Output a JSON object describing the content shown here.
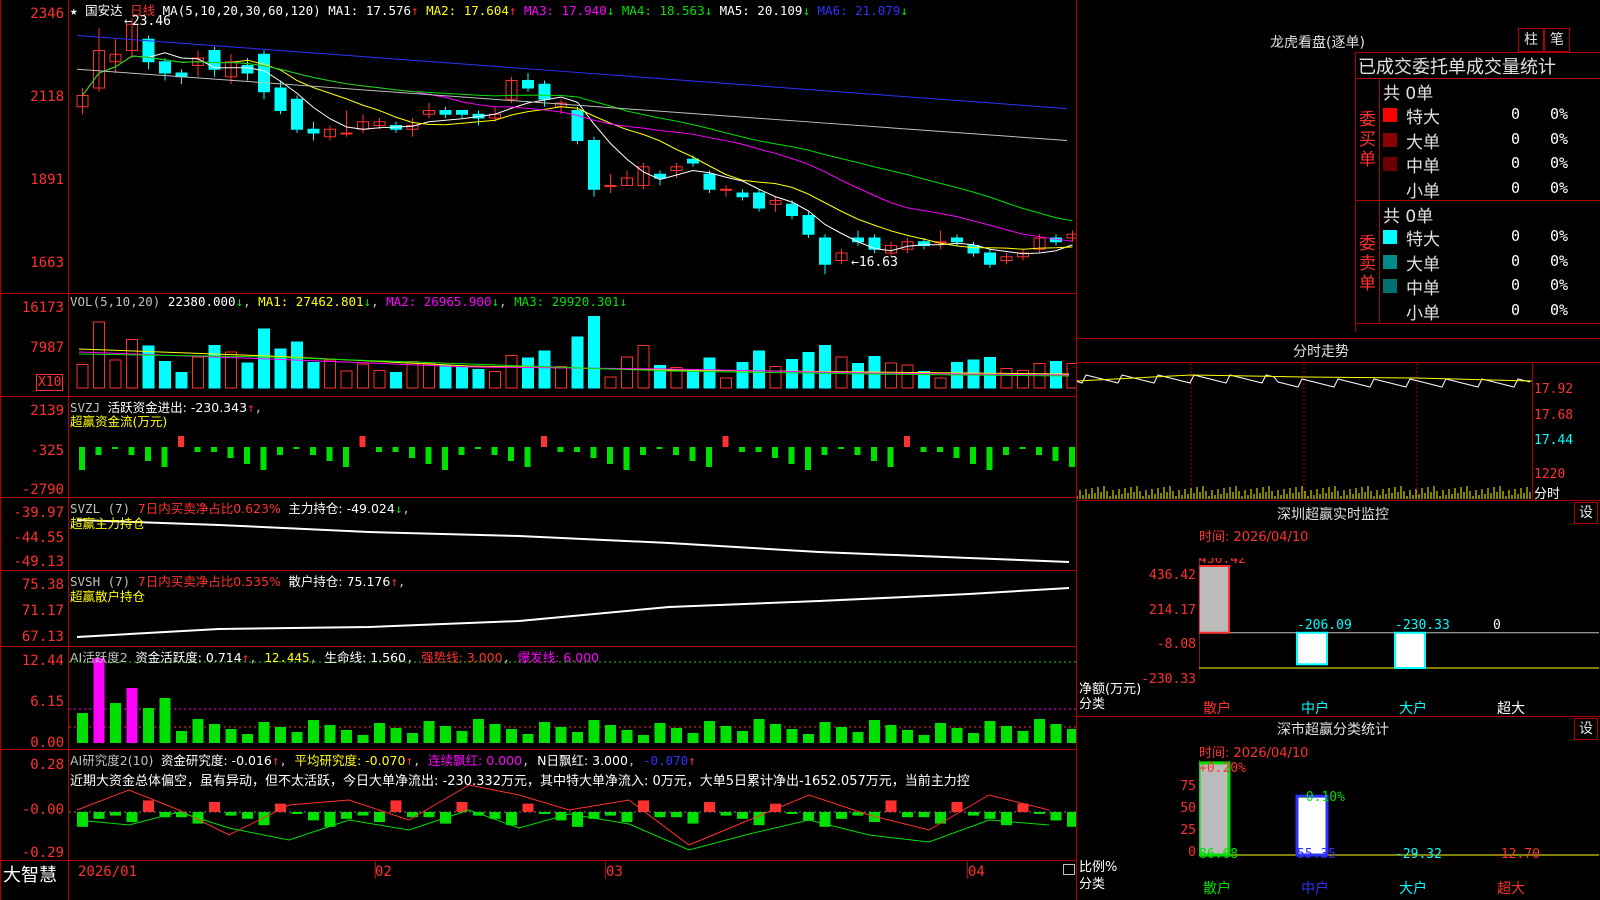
{
  "colors": {
    "up": "#ff3030",
    "down": "#00ffff",
    "ma1": "#ffffff",
    "ma2": "#ffff00",
    "ma3": "#ff00ff",
    "ma4": "#00e000",
    "ma5": "#c0c0c0",
    "ma6": "#3030ff",
    "grid": "#b00000"
  },
  "header": {
    "star_icon": "star-icon",
    "stock_name": "国安达",
    "period": "日线",
    "ma_params": "MA(5,10,20,30,60,120)",
    "ma1": "MA1: 17.576",
    "ma2": "MA2: 17.604",
    "ma3": "MA3: 17.940",
    "ma4": "MA4: 18.563",
    "ma5": "MA5: 20.109",
    "ma6": "MA6: 21.079",
    "arrow_up": "↑",
    "arrow_down": "↓"
  },
  "price_panel": {
    "y_labels": [
      "2346",
      "2118",
      "1891",
      "1663"
    ],
    "high_mark": "23.46",
    "low_mark": "16.63",
    "candles": [
      {
        "o": 21.1,
        "c": 21.4,
        "h": 21.6,
        "l": 20.9
      },
      {
        "o": 21.6,
        "c": 22.6,
        "h": 23.2,
        "l": 21.5
      },
      {
        "o": 22.3,
        "c": 22.5,
        "h": 22.9,
        "l": 22.0
      },
      {
        "o": 22.6,
        "c": 23.3,
        "h": 23.46,
        "l": 22.4
      },
      {
        "o": 22.9,
        "c": 22.3,
        "h": 23.0,
        "l": 22.1
      },
      {
        "o": 22.3,
        "c": 22.0,
        "h": 22.4,
        "l": 21.8
      },
      {
        "o": 22.0,
        "c": 21.9,
        "h": 22.1,
        "l": 21.7
      },
      {
        "o": 22.2,
        "c": 22.4,
        "h": 22.6,
        "l": 21.9
      },
      {
        "o": 22.6,
        "c": 22.1,
        "h": 22.7,
        "l": 21.9
      },
      {
        "o": 21.9,
        "c": 22.3,
        "h": 22.5,
        "l": 21.7
      },
      {
        "o": 22.2,
        "c": 22.0,
        "h": 22.4,
        "l": 21.8
      },
      {
        "o": 22.5,
        "c": 21.5,
        "h": 22.6,
        "l": 21.3
      },
      {
        "o": 21.6,
        "c": 21.0,
        "h": 21.8,
        "l": 20.9
      },
      {
        "o": 21.3,
        "c": 20.5,
        "h": 21.4,
        "l": 20.4
      },
      {
        "o": 20.5,
        "c": 20.4,
        "h": 20.7,
        "l": 20.2
      },
      {
        "o": 20.3,
        "c": 20.5,
        "h": 20.6,
        "l": 20.2
      },
      {
        "o": 20.4,
        "c": 20.4,
        "h": 21.0,
        "l": 20.3
      },
      {
        "o": 20.5,
        "c": 20.7,
        "h": 20.9,
        "l": 20.4
      },
      {
        "o": 20.6,
        "c": 20.7,
        "h": 20.8,
        "l": 20.5
      },
      {
        "o": 20.6,
        "c": 20.5,
        "h": 20.7,
        "l": 20.4
      },
      {
        "o": 20.5,
        "c": 20.6,
        "h": 20.8,
        "l": 20.3
      },
      {
        "o": 20.9,
        "c": 21.0,
        "h": 21.2,
        "l": 20.8
      },
      {
        "o": 21.0,
        "c": 20.9,
        "h": 21.1,
        "l": 20.8
      },
      {
        "o": 21.0,
        "c": 20.9,
        "h": 21.0,
        "l": 20.8
      },
      {
        "o": 20.9,
        "c": 20.8,
        "h": 21.0,
        "l": 20.6
      },
      {
        "o": 20.8,
        "c": 20.9,
        "h": 21.1,
        "l": 20.7
      },
      {
        "o": 21.3,
        "c": 21.8,
        "h": 21.9,
        "l": 21.2
      },
      {
        "o": 21.8,
        "c": 21.6,
        "h": 22.0,
        "l": 21.5
      },
      {
        "o": 21.7,
        "c": 21.3,
        "h": 21.8,
        "l": 21.1
      },
      {
        "o": 21.1,
        "c": 21.2,
        "h": 21.3,
        "l": 20.9
      },
      {
        "o": 21.0,
        "c": 20.2,
        "h": 21.1,
        "l": 20.1
      },
      {
        "o": 20.2,
        "c": 18.9,
        "h": 20.3,
        "l": 18.7
      },
      {
        "o": 19.0,
        "c": 19.0,
        "h": 19.3,
        "l": 18.8
      },
      {
        "o": 19.0,
        "c": 19.2,
        "h": 19.4,
        "l": 19.0
      },
      {
        "o": 19.0,
        "c": 19.5,
        "h": 19.6,
        "l": 18.9
      },
      {
        "o": 19.3,
        "c": 19.2,
        "h": 19.4,
        "l": 19.0
      },
      {
        "o": 19.4,
        "c": 19.5,
        "h": 19.6,
        "l": 19.2
      },
      {
        "o": 19.7,
        "c": 19.6,
        "h": 19.8,
        "l": 19.5
      },
      {
        "o": 19.3,
        "c": 18.9,
        "h": 19.4,
        "l": 18.8
      },
      {
        "o": 18.9,
        "c": 18.9,
        "h": 19.0,
        "l": 18.7
      },
      {
        "o": 18.8,
        "c": 18.7,
        "h": 18.9,
        "l": 18.6
      },
      {
        "o": 18.8,
        "c": 18.4,
        "h": 18.9,
        "l": 18.3
      },
      {
        "o": 18.5,
        "c": 18.6,
        "h": 18.7,
        "l": 18.3
      },
      {
        "o": 18.5,
        "c": 18.2,
        "h": 18.6,
        "l": 18.1
      },
      {
        "o": 18.2,
        "c": 17.7,
        "h": 18.3,
        "l": 17.6
      },
      {
        "o": 17.6,
        "c": 16.9,
        "h": 17.7,
        "l": 16.63
      },
      {
        "o": 17.0,
        "c": 17.2,
        "h": 17.3,
        "l": 16.9
      },
      {
        "o": 17.6,
        "c": 17.5,
        "h": 17.8,
        "l": 17.4
      },
      {
        "o": 17.6,
        "c": 17.3,
        "h": 17.7,
        "l": 17.2
      },
      {
        "o": 17.2,
        "c": 17.4,
        "h": 17.5,
        "l": 17.1
      },
      {
        "o": 17.3,
        "c": 17.5,
        "h": 17.6,
        "l": 17.2
      },
      {
        "o": 17.5,
        "c": 17.4,
        "h": 17.6,
        "l": 17.3
      },
      {
        "o": 17.5,
        "c": 17.5,
        "h": 17.8,
        "l": 17.3
      },
      {
        "o": 17.6,
        "c": 17.5,
        "h": 17.7,
        "l": 17.4
      },
      {
        "o": 17.4,
        "c": 17.2,
        "h": 17.5,
        "l": 17.1
      },
      {
        "o": 17.2,
        "c": 16.9,
        "h": 17.3,
        "l": 16.8
      },
      {
        "o": 17.0,
        "c": 17.1,
        "h": 17.2,
        "l": 16.9
      },
      {
        "o": 17.1,
        "c": 17.2,
        "h": 17.3,
        "l": 17.0
      },
      {
        "o": 17.3,
        "c": 17.6,
        "h": 17.7,
        "l": 17.2
      },
      {
        "o": 17.6,
        "c": 17.5,
        "h": 17.7,
        "l": 17.4
      },
      {
        "o": 17.6,
        "c": 17.7,
        "h": 17.8,
        "l": 17.5
      }
    ]
  },
  "vol_panel": {
    "legend_name": "VOL(5,10,20)",
    "legend_val": "22380.000",
    "ma1": "MA1: 27462.801",
    "ma2": "MA2: 26965.900",
    "ma3": "MA3: 29920.301",
    "y_labels": [
      "16173",
      "7987"
    ],
    "unit": "X10"
  },
  "svzj_panel": {
    "legend_name": "SVZJ",
    "legend_text": "活跃资金进出: -230.343",
    "subtitle": "超赢资金流(万元)",
    "y_labels": [
      "2139",
      "-325",
      "-2790"
    ]
  },
  "svzl_panel": {
    "legend_name": "SVZL (7)",
    "legend_text": "7日内买卖净占比0.623%",
    "legend_text2": "主力持仓: -49.024",
    "subtitle": "超赢主力持仓",
    "y_labels": [
      "-39.97",
      "-44.55",
      "-49.13"
    ]
  },
  "svsh_panel": {
    "legend_name": "SVSH (7)",
    "legend_text": "7日内买卖净占比0.535%",
    "legend_text2": "散户持仓: 75.176",
    "subtitle": "超赢散户持仓",
    "y_labels": [
      "75.38",
      "71.17",
      "67.13"
    ]
  },
  "ai_active_panel": {
    "legend_name": "AI活跃度2",
    "legend_text": "资金活跃度: 0.714",
    "val2": "12.445",
    "life": "生命线: 1.560",
    "strong": "强势线: 3.000",
    "burst": "爆发线: 6.000",
    "y_labels": [
      "12.44",
      "6.15",
      "0.00"
    ]
  },
  "ai_research_panel": {
    "legend_name": "AI研究度2(10)",
    "legend_text": "资金研究度: -0.016",
    "avg": "平均研究度: -0.070",
    "streak": "连续飘红: 0.000",
    "nday": "N日飘红: 3.000",
    "last": "-0.070",
    "note": "近期大资金总体偏空，虽有异动，但不太活跃，今日大单净流出: -230.332万元，其中特大单净流入: 0万元，大单5日累计净出-1652.057万元，当前主力控",
    "y_labels": [
      "0.28",
      "-0.00",
      "-0.29"
    ]
  },
  "footer": {
    "brand": "大智慧",
    "dates": [
      "2026/01",
      "02",
      "03",
      "04"
    ],
    "lock_icon": "lock-icon"
  },
  "right": {
    "dragon_title": "龙虎看盘(逐单)",
    "btn_zhu": "柱",
    "btn_bi": "笔",
    "table_title": "已成交委托单成交量统计",
    "buy_group": "委买单",
    "sell_group": "委卖单",
    "buy_total": "共 0单",
    "sell_total": "共 0单",
    "buy_rows": [
      {
        "label": "特大",
        "val": "0",
        "pct": "0%",
        "color": "#ff0000"
      },
      {
        "label": "大单",
        "val": "0",
        "pct": "0%",
        "color": "#8b0000"
      },
      {
        "label": "中单",
        "val": "0",
        "pct": "0%",
        "color": "#6b0000"
      },
      {
        "label": "小单",
        "val": "0",
        "pct": "0%",
        "color": ""
      }
    ],
    "sell_rows": [
      {
        "label": "特大",
        "val": "0",
        "pct": "0%",
        "color": "#00ffff"
      },
      {
        "label": "大单",
        "val": "0",
        "pct": "0%",
        "color": "#008b8b"
      },
      {
        "label": "中单",
        "val": "0",
        "pct": "0%",
        "color": "#007070"
      },
      {
        "label": "小单",
        "val": "0",
        "pct": "0%",
        "color": ""
      }
    ],
    "intraday_title": "分时走势",
    "intraday_labels": [
      "17.92",
      "17.68",
      "17.44",
      "1220",
      "分时"
    ],
    "sz_monitor_title": "深圳超赢实时监控",
    "sz_set": "设",
    "sz_time": "时间: 2026/04/10",
    "sz_y_labels": [
      "436.42",
      "214.17",
      "-8.08",
      "-230.33"
    ],
    "sz_values": [
      {
        "cat": "散户",
        "val": 436.42,
        "label": "436.42"
      },
      {
        "cat": "中户",
        "val": -206.09,
        "label": "-206.09"
      },
      {
        "cat": "大户",
        "val": -230.33,
        "label": "-230.33"
      },
      {
        "cat": "超大",
        "val": 0,
        "label": "0"
      }
    ],
    "sz_axis_name": "净额(万元)",
    "sz_axis_cat": "分类",
    "sh_stat_title": "深市超赢分类统计",
    "sh_set": "设",
    "sh_time": "时间: 2026/04/10",
    "sh_y_labels": [
      "75",
      "50",
      "25",
      "0"
    ],
    "sh_top_labels": [
      "+0.20%",
      "-0.10%"
    ],
    "sh_values": [
      {
        "cat": "散户",
        "val": 86.68,
        "label": "86.68"
      },
      {
        "cat": "中户",
        "val": 55.35,
        "label": "55.35"
      },
      {
        "cat": "大户",
        "val": -29.32,
        "label": "-29.32"
      },
      {
        "cat": "超大",
        "val": -12.7,
        "label": "-12.70"
      }
    ],
    "sh_axis_name": "比例%",
    "sh_axis_cat": "分类"
  }
}
